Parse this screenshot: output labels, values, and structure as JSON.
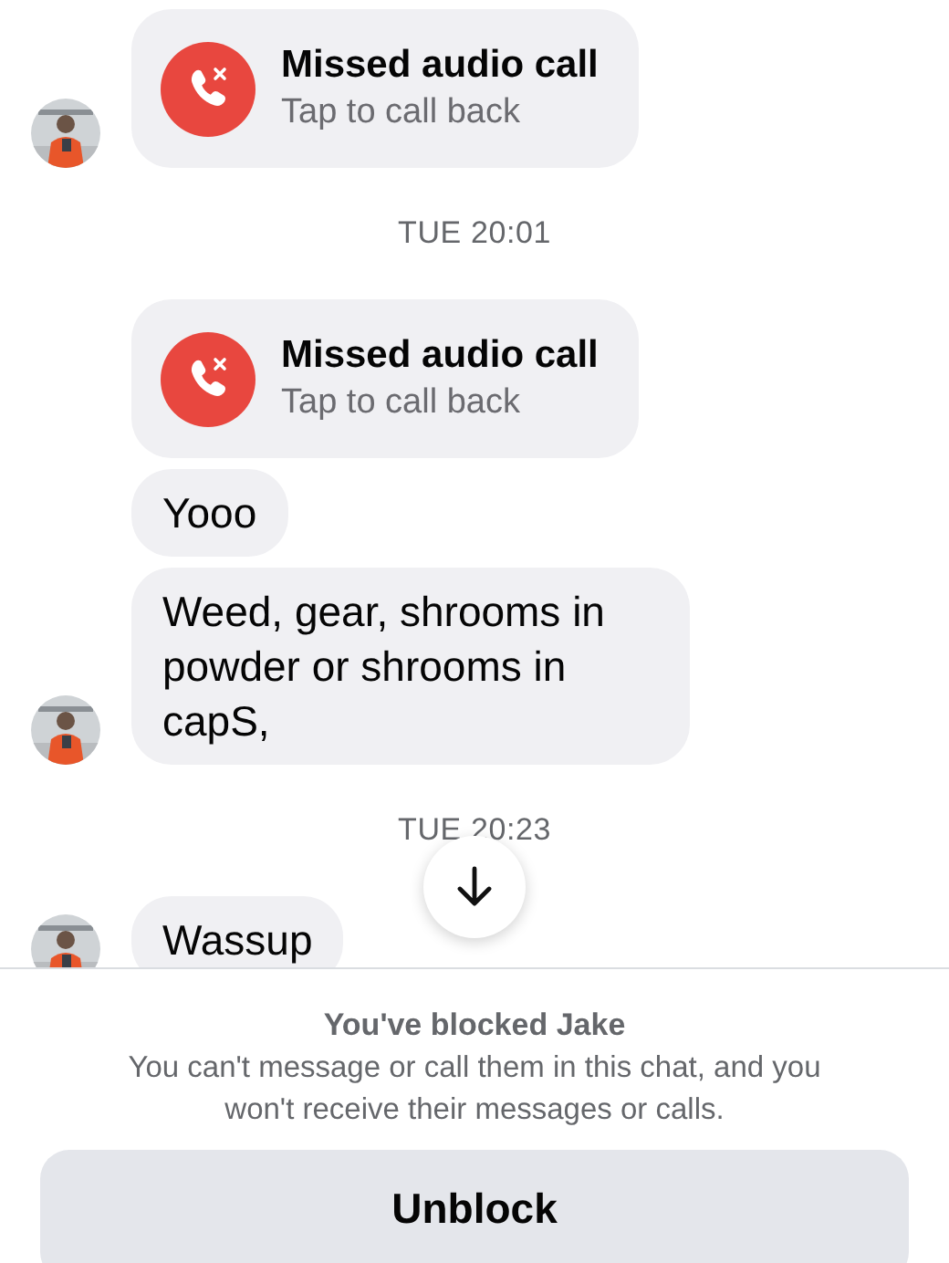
{
  "messages": [
    {
      "kind": "call",
      "title": "Missed audio call",
      "subtitle": "Tap to call back",
      "avatar": true
    },
    {
      "kind": "time",
      "text": "TUE 20:01"
    },
    {
      "kind": "call",
      "title": "Missed audio call",
      "subtitle": "Tap to call back",
      "avatar": false
    },
    {
      "kind": "text",
      "text": "Yooo",
      "avatar": false
    },
    {
      "kind": "text",
      "text": "Weed, gear, shrooms in powder or shrooms in capS,",
      "avatar": true
    },
    {
      "kind": "time",
      "text": "TUE 20:23"
    },
    {
      "kind": "text",
      "text": "Wassup",
      "avatar": true
    }
  ],
  "blocked": {
    "title": "You've blocked Jake",
    "message": "You can't message or call them in this chat, and you won't receive their messages or calls."
  },
  "unblock_button": "Unblock"
}
